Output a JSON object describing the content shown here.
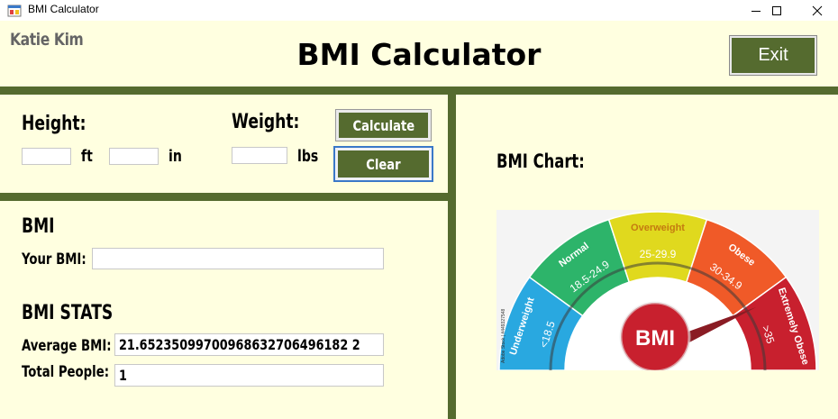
{
  "window": {
    "title": "BMI Calculator",
    "icons": [
      "app-icon",
      "minimize-icon",
      "maximize-icon",
      "close-icon"
    ]
  },
  "header": {
    "user_name": "Katie Kim",
    "title": "BMI Calculator",
    "exit_label": "Exit"
  },
  "input_panel": {
    "height_label": "Height:",
    "feet_unit": "ft",
    "inches_unit": "in",
    "feet_value": "",
    "inches_value": "",
    "weight_label": "Weight:",
    "weight_unit": "lbs",
    "weight_value": "",
    "calculate_label": "Calculate",
    "clear_label": "Clear"
  },
  "results_panel": {
    "bmi_heading": "BMI",
    "your_bmi_label": "Your BMI:",
    "your_bmi_value": "",
    "stats_heading": "BMI STATS",
    "average_label": "Average BMI:",
    "average_value": "21.65235099700968632706496182 2",
    "total_label": "Total People:",
    "total_value": "1"
  },
  "chart_panel": {
    "label": "BMI Chart:",
    "gauge": {
      "center_label": "BMI",
      "watermark": "Adobe Stock | #449327548",
      "segments": [
        {
          "name": "Underweight",
          "range": "<18.5",
          "color": "#29a8e0"
        },
        {
          "name": "Normal",
          "range": "18.5-24.9",
          "color": "#2db46a"
        },
        {
          "name": "Overweight",
          "range": "25-29.9",
          "color": "#e0d91e"
        },
        {
          "name": "Obese",
          "range": "30-34.9",
          "color": "#f05a28"
        },
        {
          "name": "Extremely Obese",
          "range": ">35",
          "color": "#c8202e"
        }
      ]
    }
  },
  "colors": {
    "background": "#ffffe0",
    "accent_green": "#556b2f"
  }
}
